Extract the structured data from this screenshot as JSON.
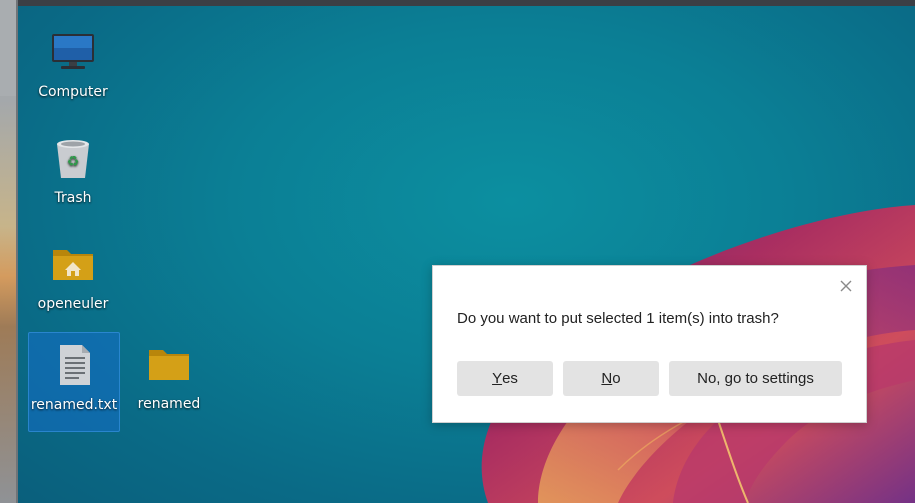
{
  "desktop": {
    "icons": [
      {
        "label": "Computer",
        "icon": "computer-icon"
      },
      {
        "label": "Trash",
        "icon": "trash-icon"
      },
      {
        "label": "openeuler",
        "icon": "home-folder-icon"
      },
      {
        "label": "renamed.txt",
        "icon": "text-file-icon",
        "selected": true
      },
      {
        "label": "renamed",
        "icon": "folder-icon"
      }
    ]
  },
  "dialog": {
    "message": "Do you want to put selected 1 item(s) into trash?",
    "buttons": {
      "yes": {
        "mnemonic": "Y",
        "rest": "es"
      },
      "no": {
        "mnemonic": "N",
        "rest": "o"
      },
      "settings": {
        "label": "No, go to settings"
      }
    },
    "close_icon": "close-icon"
  },
  "colors": {
    "desktop_teal": "#0b7f95",
    "selection": "#1f6fc0",
    "button_bg": "#e3e3e3"
  }
}
